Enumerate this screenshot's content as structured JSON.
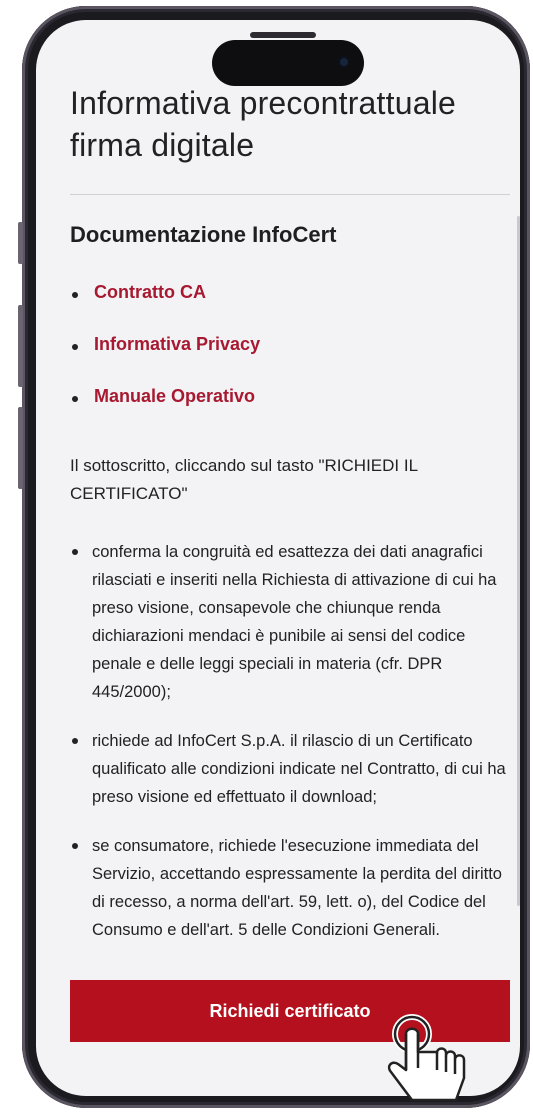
{
  "page": {
    "title_line1": "Informativa precontrattuale",
    "title_line2": "firma digitale",
    "section_title": "Documentazione InfoCert",
    "links": [
      "Contratto CA",
      "Informativa Privacy",
      "Manuale Operativo"
    ],
    "intro": "Il sottoscritto, cliccando sul tasto \"RICHIEDI IL CERTIFICATO\"",
    "bullets": [
      "conferma la congruità ed esattezza dei dati anagrafici rilasciati e inseriti nella Richiesta di attivazione di cui ha preso visione, consapevole che chiunque renda dichiarazioni mendaci è punibile ai sensi del codice penale e delle leggi speciali in materia (cfr. DPR 445/2000);",
      "richiede ad InfoCert S.p.A. il rilascio di un Certificato qualificato alle condizioni indicate nel Contratto, di cui ha preso visione ed effettuato il download;",
      "se consumatore, richiede l'esecuzione immediata del Servizio, accettando espressamente la perdita del diritto di recesso, a norma dell'art. 59, lett. o), del Codice del Consumo e dell'art. 5 delle Condizioni Generali."
    ],
    "cta_label": "Richiedi certificato"
  },
  "colors": {
    "link": "#a71930",
    "cta_bg": "#b4101d",
    "screen_bg": "#f3f3f6"
  },
  "icons": {
    "pointer": "hand-pointer-icon"
  }
}
